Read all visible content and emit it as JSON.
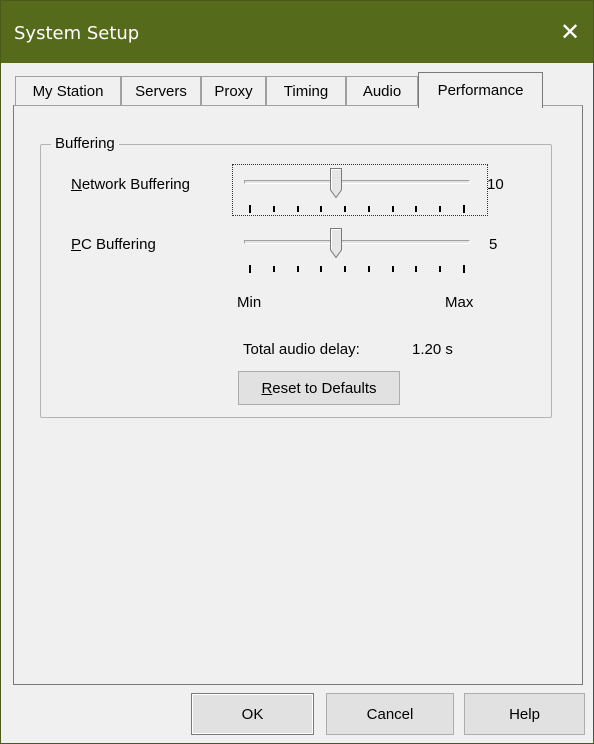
{
  "window": {
    "title": "System Setup",
    "close_glyph": "✕"
  },
  "tabs": [
    {
      "label": "My Station"
    },
    {
      "label": "Servers"
    },
    {
      "label": "Proxy"
    },
    {
      "label": "Timing"
    },
    {
      "label": "Audio"
    },
    {
      "label": "Performance",
      "active": true
    }
  ],
  "buffering": {
    "group_label": "Buffering",
    "network": {
      "label_access": "N",
      "label_rest": "etwork Buffering",
      "value": "10",
      "position_fraction": 0.4
    },
    "pc": {
      "label_access": "P",
      "label_rest": "C Buffering",
      "value": "5",
      "position_fraction": 0.4
    },
    "ticks": 10,
    "min_label": "Min",
    "max_label": "Max",
    "total_delay_label": "Total audio delay:",
    "total_delay_value": "1.20 s",
    "reset_access": "R",
    "reset_rest": "eset to Defaults"
  },
  "buttons": {
    "ok": "OK",
    "cancel": "Cancel",
    "help": "Help"
  },
  "colors": {
    "titlebar": "#566a1b",
    "face": "#f0f0f0"
  }
}
